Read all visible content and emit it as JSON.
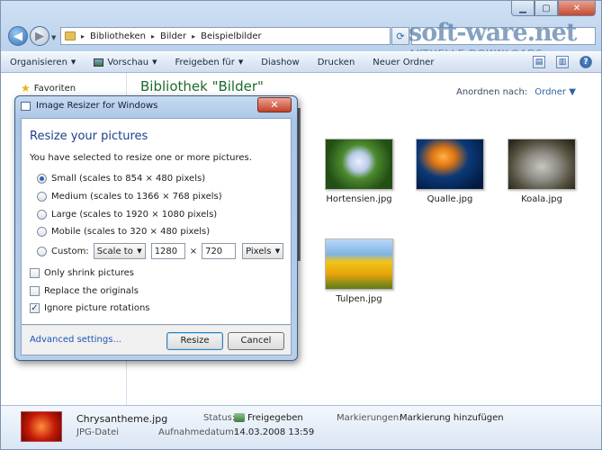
{
  "window": {
    "min": "▁",
    "max": "▢",
    "close": "✕"
  },
  "nav": {
    "back": "◀",
    "forward": "▶"
  },
  "address": {
    "crumbs": [
      "Bibliotheken",
      "Bilder",
      "Beispielbilder"
    ],
    "sep": "▸"
  },
  "brand": {
    "name": "soft-ware.net",
    "tagline": "AKTUELLE DOWNLOADS"
  },
  "toolbar": {
    "organize": "Organisieren",
    "preview": "Vorschau",
    "share": "Freigeben für",
    "slideshow": "Diashow",
    "print": "Drucken",
    "new_folder": "Neuer Ordner",
    "help": "?"
  },
  "leftpane": {
    "favorites": "Favoriten"
  },
  "library": {
    "title": "Bibliothek \"Bilder\"",
    "arrange_label": "Anordnen nach:",
    "arrange_value": "Ordner"
  },
  "files": [
    {
      "name": "Hortensien.jpg"
    },
    {
      "name": "Qualle.jpg"
    },
    {
      "name": "Koala.jpg"
    },
    {
      "name": "Tulpen.jpg"
    }
  ],
  "status": {
    "filename": "Chrysantheme.jpg",
    "filetype": "JPG-Datei",
    "status_label": "Status:",
    "status_value": "Freigegeben",
    "date_label": "Aufnahmedatum:",
    "date_value": "14.03.2008 13:59",
    "tags_label": "Markierungen:",
    "tags_value": "Markierung hinzufügen"
  },
  "dialog": {
    "title": "Image Resizer for Windows",
    "close": "✕",
    "heading": "Resize your pictures",
    "subtitle": "You have selected to resize one or more pictures.",
    "options": [
      {
        "label": "Small (scales to 854 × 480 pixels)",
        "selected": true
      },
      {
        "label": "Medium (scales to 1366 × 768 pixels)",
        "selected": false
      },
      {
        "label": "Large (scales to 1920 × 1080 pixels)",
        "selected": false
      },
      {
        "label": "Mobile (scales to 320 × 480 pixels)",
        "selected": false
      }
    ],
    "custom_label": "Custom:",
    "custom_mode": "Scale to",
    "custom_width": "1280",
    "custom_x": "×",
    "custom_height": "720",
    "custom_unit": "Pixels",
    "only_shrink": "Only shrink pictures",
    "replace": "Replace the originals",
    "ignore_rotation": "Ignore picture rotations",
    "ignore_rotation_checked": true,
    "advanced": "Advanced settings...",
    "resize": "Resize",
    "cancel": "Cancel"
  }
}
